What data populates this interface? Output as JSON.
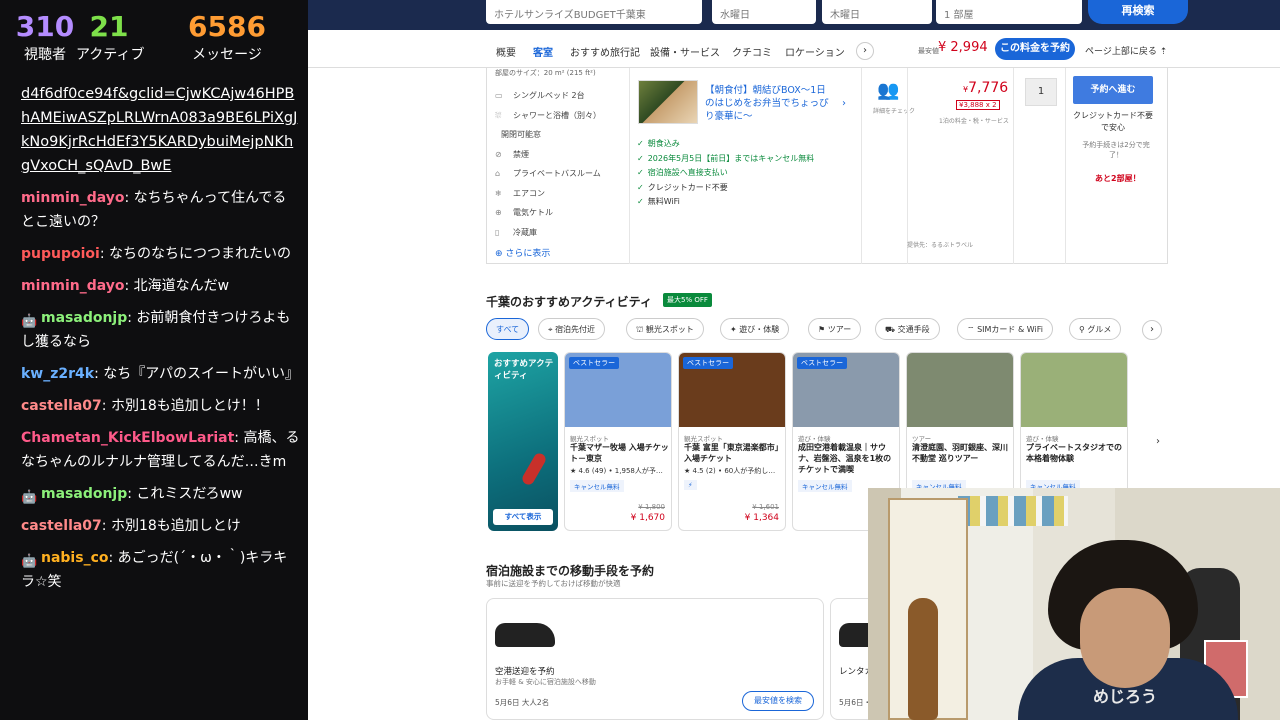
{
  "stats": {
    "viewers": {
      "value": "310",
      "label": "視聴者",
      "color": "#b48cff"
    },
    "active": {
      "value": "21",
      "label": "アクティブ",
      "color": "#7ee04a"
    },
    "messages": {
      "value": "6586",
      "label": "メッセージ",
      "color": "#ff9c33"
    }
  },
  "chat": {
    "link_text": "d4f6df0ce94f&gclid=CjwKCAjw46HPBhAMEiwASZpLRLWrnA083a9BE6LPiXgJkNo9KjrRcHdEf3Y5KARDybuiMejpNKhgVxoCH_sQAvD_BwE",
    "messages": [
      {
        "user": "minmin_dayo",
        "color": "#ff6b8a",
        "text": "なちちゃんって住んでるとこ遠いの？",
        "bot": false
      },
      {
        "user": "pupupoioi",
        "color": "#ff5a5a",
        "text": "なちのなちにつつまれたいの",
        "bot": false
      },
      {
        "user": "minmin_dayo",
        "color": "#ff6b8a",
        "text": "北海道なんだw",
        "bot": false
      },
      {
        "user": "masadonjp",
        "color": "#8cf07a",
        "text": "お前朝食付きつけろよもし獲るなら",
        "bot": true
      },
      {
        "user": "kw_z2r4k",
        "color": "#6ab0ff",
        "text": "なち『アパのスイートがいい』",
        "bot": false
      },
      {
        "user": "castella07",
        "color": "#ff8a8a",
        "text": "ホ別18も追加しとけ！！",
        "bot": false
      },
      {
        "user": "Chametan_KickElbowLariat",
        "color": "#ff5a8a",
        "text": "高橋、るなちゃんのルナルナ管理してるんだ…きm",
        "bot": false
      },
      {
        "user": "masadonjp",
        "color": "#8cf07a",
        "text": "これミスだろww",
        "bot": true
      },
      {
        "user": "castella07",
        "color": "#ff8a8a",
        "text": "ホ別18も追加しとけ",
        "bot": false
      },
      {
        "user": "nabis_co",
        "color": "#ffb020",
        "text": "あごっだ(´・ω・｀)キラキラ☆笑",
        "bot": true
      }
    ]
  },
  "searchbar": {
    "field1": "ホテルサンライズBUDGET千葉東",
    "checkin": "水曜日",
    "checkout": "木曜日",
    "rooms": "1 部屋",
    "search_label": "再検索"
  },
  "tabs": [
    "概要",
    "客室",
    "おすすめ旅行記",
    "設備・サービス",
    "クチコミ",
    "ロケーション"
  ],
  "tab_active_index": 1,
  "topbar": {
    "fee_label": "最安値",
    "fee_price": "¥ 2,994",
    "reserve_label": "この料金を予約",
    "to_top": "ページ上部に戻る"
  },
  "room": {
    "size_text": "部屋のサイズ：20 m² (215 ft²)",
    "amenities": [
      "シングルベッド 2台",
      "シャワーと浴槽（別々）",
      "開閉可能窓",
      "禁煙",
      "プライベートバスルーム",
      "エアコン",
      "電気ケトル",
      "冷蔵庫"
    ],
    "more_label": "さらに表示",
    "plan_title": "【朝食付】朝結びBOX〜1日のはじめをお弁当でちょっぴり豪華に〜",
    "conditions": [
      "朝食込み",
      "2026年5月5日【前日】まではキャンセル無料",
      "宿泊施設へ直接支払い",
      "クレジットカード不要",
      "無料WiFi"
    ],
    "people_label": "詳細をチェック",
    "price": "7,776",
    "price_currency": "¥",
    "price_sub": "¥3,888 x 2",
    "price_note": "1泊の料金・税・サービス",
    "provider": "提供先：るるぶトラベル",
    "qty": "1",
    "book_label": "予約へ進む",
    "nocard_label": "クレジットカード不要で安心",
    "quick_label": "予約手続きは2分で完了！",
    "rooms_left": "あと2部屋！"
  },
  "activities": {
    "title": "千葉のおすすめアクティビティ",
    "badge": "最大5% OFF",
    "chips": [
      "すべて",
      "宿泊先付近",
      "観光スポット",
      "遊び・体験",
      "ツアー",
      "交通手段",
      "SIMカード & WiFi",
      "グルメ"
    ],
    "promo_title": "おすすめアクティビティ",
    "promo_button": "すべて表示",
    "cards": [
      {
        "badge": "ベストセラー",
        "category": "観光スポット",
        "name": "千葉マザー牧場 入場チケット－東京",
        "rating": "★ 4.6 (49) • 1,958人が予…",
        "cancel": "キャンセル無料",
        "old_price": "¥ 1,800",
        "price": "¥ 1,670",
        "color": "#7aa0d8"
      },
      {
        "badge": "ベストセラー",
        "category": "観光スポット",
        "name": "千葉 富里「東京湯楽都市」入場チケット",
        "rating": "★ 4.5 (2) • 60人が予約し…",
        "cancel": "⚡",
        "old_price": "¥ 1,601",
        "price": "¥ 1,364",
        "color": "#6a3c1c"
      },
      {
        "badge": "ベストセラー",
        "category": "遊び・体験",
        "name": "成田空港着載温泉｜サウナ、岩盤浴、温泉を1枚のチケットで満喫",
        "rating": "",
        "cancel": "キャンセル無料",
        "old_price": "",
        "price": "",
        "color": "#8a9aac"
      },
      {
        "badge": "",
        "category": "ツアー",
        "name": "清澄庭園、羽町銀座、深川不動堂 巡りツアー",
        "rating": "",
        "cancel": "キャンセル無料",
        "old_price": "",
        "price": "",
        "color": "#7e8a70"
      },
      {
        "badge": "",
        "category": "遊び・体験",
        "name": "プライベートスタジオでの本格着物体験",
        "rating": "",
        "cancel": "キャンセル無料",
        "old_price": "",
        "price": "",
        "color": "#9ab078"
      }
    ]
  },
  "transport": {
    "title": "宿泊施設までの移動手段を予約",
    "subtitle": "事前に送迎を予約しておけば移動が快適",
    "cards": [
      {
        "name": "空港送迎を予約",
        "desc": "お手軽 & 安心に宿泊施設へ移動",
        "date": "5月6日 大人2名",
        "button": "最安値を検索"
      },
      {
        "name": "レンタカー",
        "desc": "",
        "date": "5月6日・",
        "button": ""
      }
    ]
  },
  "webcam": {
    "shirt_text": "めじろう"
  }
}
